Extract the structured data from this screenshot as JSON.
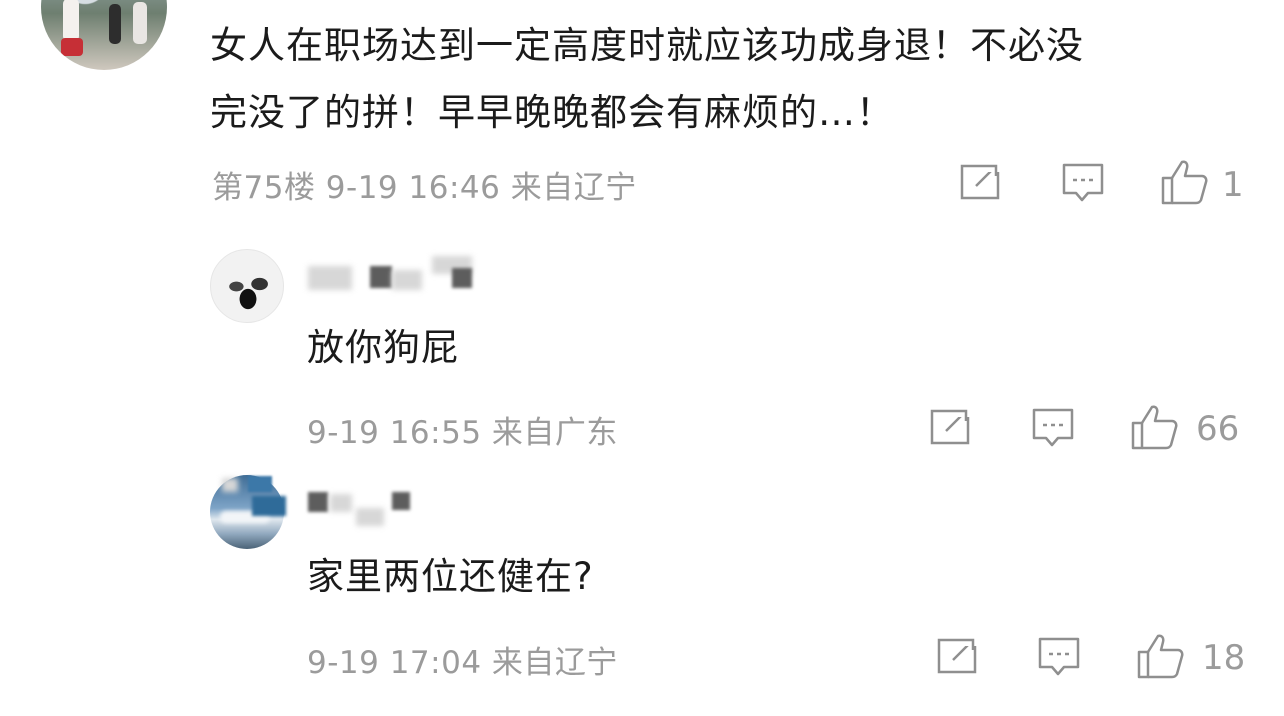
{
  "main_comment": {
    "text_line1": "女人在职场达到一定高度时就应该功成身退！不必没",
    "text_line2": "完没了的拼！早早晚晚都会有麻烦的…！",
    "meta": "第75楼 9-19 16:46 来自辽宁",
    "likes": "1"
  },
  "replies": [
    {
      "text": "放你狗屁",
      "meta": "9-19 16:55 来自广东",
      "likes": "66"
    },
    {
      "text": "家里两位还健在?",
      "meta": "9-19 17:04 来自辽宁",
      "likes": "18"
    }
  ],
  "icons": [
    "edit-icon",
    "comment-icon",
    "thumbs-up-icon"
  ],
  "colors": {
    "text": "#1b1b1b",
    "meta": "#9b9b9b"
  }
}
